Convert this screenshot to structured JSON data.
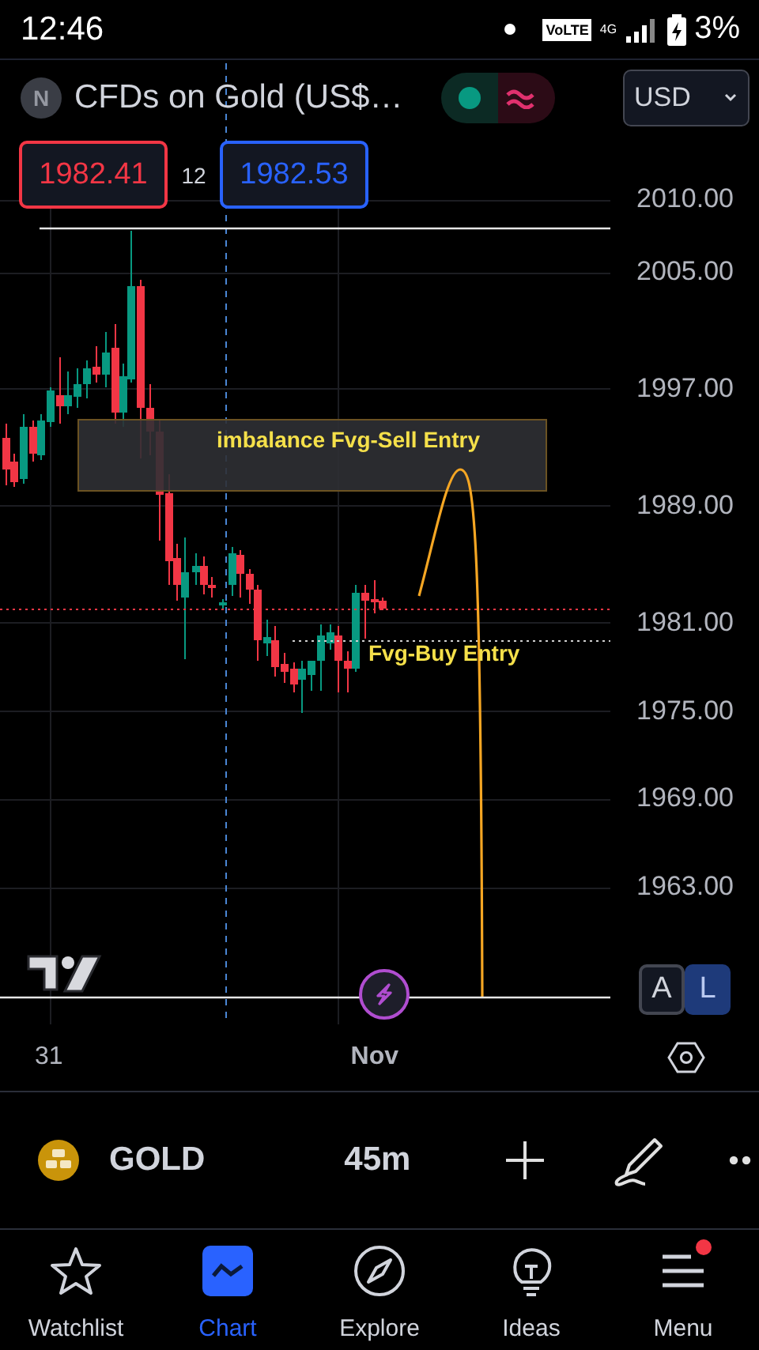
{
  "status_bar": {
    "time": "12:46",
    "network_badge": "VoLTE",
    "network_type": "4G",
    "battery": "3%"
  },
  "header": {
    "symbol_initial": "N",
    "title": "CFDs on Gold (US$…",
    "currency": "USD"
  },
  "quote": {
    "bid": "1982.41",
    "spread": "12",
    "ask": "1982.53"
  },
  "chart": {
    "price_axis": [
      "2010.00",
      "2005.00",
      "1997.00",
      "1989.00",
      "1981.00",
      "1975.00",
      "1969.00",
      "1963.00"
    ],
    "time_axis": [
      "31",
      "Nov"
    ],
    "annotations": [
      {
        "kind": "zone",
        "text": "imbalance Fvg-Sell Entry"
      },
      {
        "kind": "line",
        "text": "Fvg-Buy Entry"
      }
    ],
    "scale_modes": [
      {
        "label": "A",
        "selected": false
      },
      {
        "label": "L",
        "selected": true
      }
    ]
  },
  "toolbar": {
    "symbol": "GOLD",
    "interval": "45m"
  },
  "nav": [
    {
      "label": "Watchlist",
      "selected": false,
      "notification": false
    },
    {
      "label": "Chart",
      "selected": true,
      "notification": false
    },
    {
      "label": "Explore",
      "selected": false,
      "notification": false
    },
    {
      "label": "Ideas",
      "selected": false,
      "notification": false
    },
    {
      "label": "Menu",
      "selected": false,
      "notification": true
    }
  ]
}
